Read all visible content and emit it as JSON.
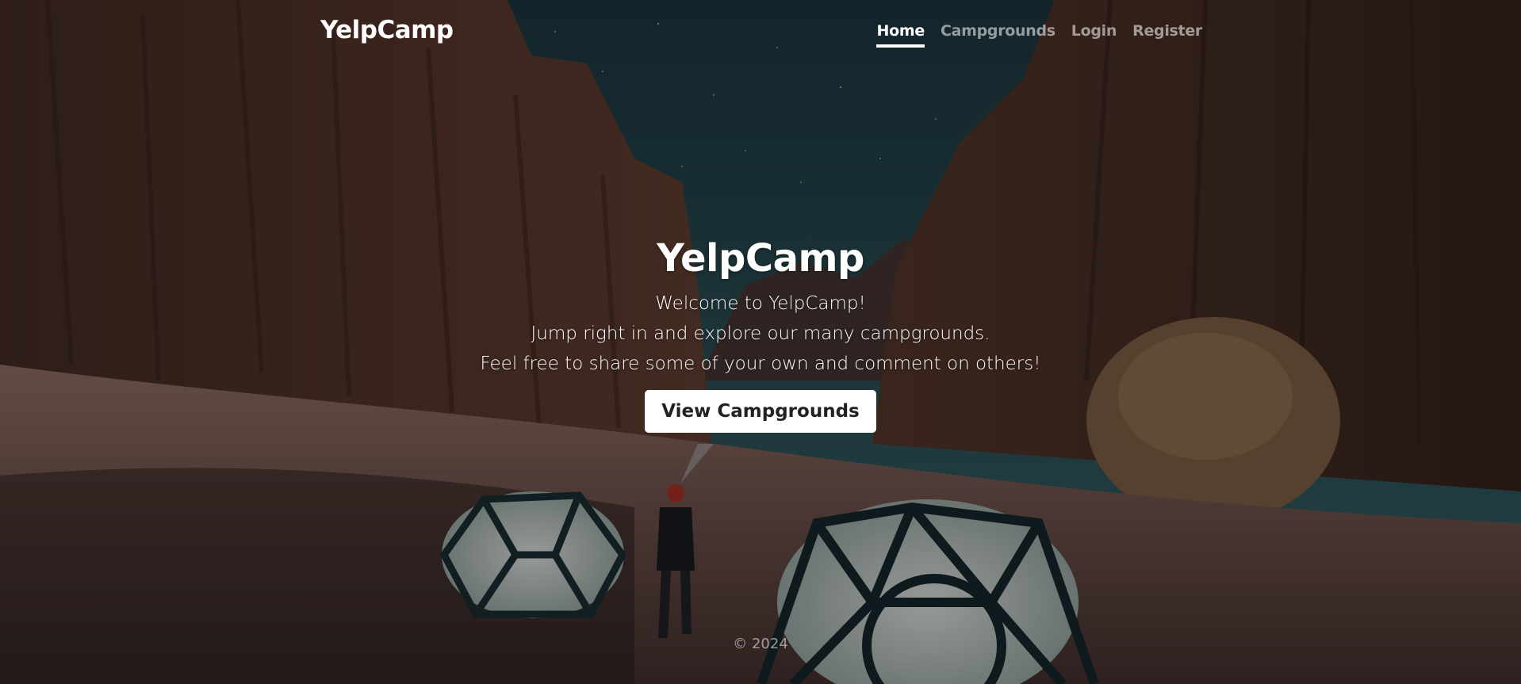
{
  "header": {
    "brand": "YelpCamp",
    "nav": [
      {
        "label": "Home",
        "active": true
      },
      {
        "label": "Campgrounds",
        "active": false
      },
      {
        "label": "Login",
        "active": false
      },
      {
        "label": "Register",
        "active": false
      }
    ]
  },
  "hero": {
    "title": "YelpCamp",
    "lines": [
      "Welcome to YelpCamp!",
      "Jump right in and explore our many campgrounds.",
      "Feel free to share some of your own and comment on others!"
    ],
    "cta_label": "View Campgrounds"
  },
  "footer": {
    "copyright": "© 2024"
  },
  "colors": {
    "nav_active": "#ffffff",
    "nav_inactive": "#8c8c8c",
    "button_bg": "#ffffff",
    "button_text": "#222222",
    "sky": "#2f5a60",
    "rock": "#5a3a30",
    "sand": "#7a5f58"
  },
  "icons": {
    "background": "desert-canyon-campsite-photo"
  }
}
